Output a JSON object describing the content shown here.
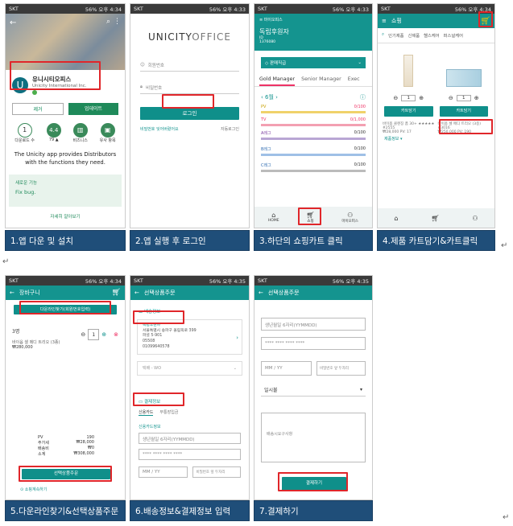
{
  "steps": [
    {
      "caption": "1.앱 다운 및 설치"
    },
    {
      "caption": "2.앱 실행 후 로그인"
    },
    {
      "caption": "3.하단의 쇼핑카트 클릭"
    },
    {
      "caption": "4.제품 카트담기&카트클릭"
    },
    {
      "caption": "5.다운라인찾기&선택상품주문"
    },
    {
      "caption": "6.배송정보&결제정보 입력"
    },
    {
      "caption": "7.결제하기"
    }
  ],
  "status": {
    "carrier": "SKT",
    "p1": "56% 오후 4:34",
    "p2": "56% 오후 4:33",
    "p3": "56% 오후 4:33",
    "p4": "56% 오후 4:34",
    "p5": "56% 오후 4:34",
    "p6": "56% 오후 4:35",
    "p7": "56% 오후 4:35"
  },
  "s1": {
    "app_name": "유니시티오피스",
    "company": "Unicity International Inc.",
    "uninstall": "제거",
    "update": "업데이트",
    "stats": [
      {
        "v": "1",
        "l": "다운로드 수"
      },
      {
        "v": "4.4",
        "l": "79 ▲"
      },
      {
        "v": "",
        "l": "비즈니스"
      },
      {
        "v": "",
        "l": "유사 항목"
      }
    ],
    "desc": "The Unicity app provides Distributors with the functions they need.",
    "new_title": "새로운 기능",
    "new_body": "Fix bug.",
    "more": "자세히 알아보기"
  },
  "s2": {
    "logo": "UNICITY",
    "logo2": "OFFICE",
    "id_ph": "회원번호",
    "pw_ph": "비밀번호",
    "login": "로그인",
    "forgot": "비밀번호 잊어버렸어요",
    "auto": "자동로그인"
  },
  "s3": {
    "title": "독립후원자",
    "sub1": "ID",
    "sub2": "1376080",
    "rank": "판매직급",
    "tabs": [
      "Gold Manager",
      "Senior Manager",
      "Exec"
    ],
    "month": "6월",
    "pv": "PV",
    "pv_val": "0/100",
    "tv": "TV",
    "tv_val": "0/1,000",
    "rows": [
      {
        "k": "A레그",
        "v": "0/100"
      },
      {
        "k": "B레그",
        "v": "0/100"
      },
      {
        "k": "C레그",
        "v": "0/100"
      }
    ],
    "nav": [
      "HOME",
      "쇼핑",
      "마이오피스"
    ]
  },
  "s4": {
    "title": "쇼핑",
    "cats": [
      "인기제품",
      "신제품",
      "헬스케어",
      "퍼스널케어"
    ],
    "qty": "1",
    "add": "카트담기",
    "p1_name": "바이옵 클렌징 폼 30+ ★★★★★",
    "p1_code": "#2555",
    "p1_price": "₩28,000",
    "p1_pv": "PV: 17",
    "p2_name": "바이옵 셀 메디 트리오 (3종)",
    "p2_code": "#3016",
    "p2_price": "₩250,000",
    "p2_pv": "PV: 190",
    "more": "제품정보 ▾"
  },
  "s5": {
    "title": "장바구니",
    "btn": "다운라인찾기(회원번호입력)",
    "qty_label": "3명",
    "item_name": "바이옵 셀 메디 트리오 (3종)",
    "item_price": "₩280,000",
    "qty": "1",
    "pv_k": "PV",
    "pv_v": "190",
    "sum_rows": [
      {
        "k": "주가세",
        "v": "₩28,000"
      },
      {
        "k": "배송비",
        "v": "₩0"
      },
      {
        "k": "소계",
        "v": "₩308,000"
      }
    ],
    "order": "선택상품주문",
    "keep": "쇼핑계속하기"
  },
  "s6": {
    "title": "선택상품주문",
    "ship_h": "배송정보",
    "name": "독립후원자",
    "addr1": "서울특별시 송파구 올림픽로 399",
    "addr2": "파셜 5-901",
    "zip": "05508",
    "phone": "01099640578",
    "select": "택배 - WO",
    "pay_h": "결제정보",
    "card": "신용카드",
    "bank": "무통장입금",
    "card_info": "신용카드정보",
    "dob_ph": "생년월일 6자리(YYMMDD)",
    "card_ph": "**** **** **** ****",
    "mm_ph": "MM / YY",
    "pw_ph": "비밀번호 앞 두자리"
  },
  "s7": {
    "title": "선택상품주문",
    "dob_ph": "생년월일 6자리(YYMMDD)",
    "card_ph": "**** **** **** ****",
    "mm_ph": "MM / YY",
    "pw_ph": "비밀번호 앞 두자리",
    "install": "일시불",
    "memo_ph": "배송시요구사항",
    "pay": "결제하기"
  }
}
